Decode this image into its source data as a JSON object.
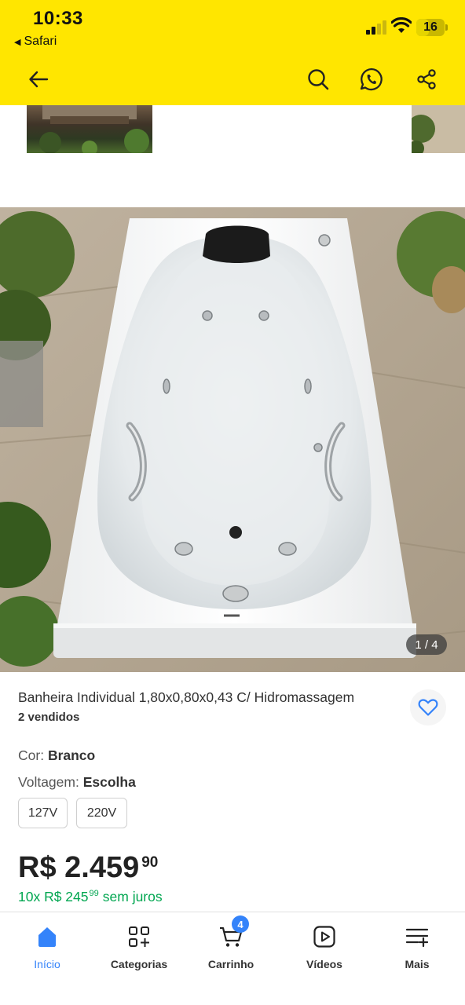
{
  "status_bar": {
    "time": "10:33",
    "back_app": "Safari",
    "battery": "16"
  },
  "header": {
    "icons": [
      "back-arrow-icon",
      "search-icon",
      "whatsapp-icon",
      "share-icon"
    ]
  },
  "gallery": {
    "counter": "1 / 4"
  },
  "product": {
    "title": "Banheira Individual 1,80x0,80x0,43 C/ Hidromassagem",
    "sold": "2 vendidos",
    "color_label": "Cor:",
    "color_value": "Branco",
    "voltage_label": "Voltagem:",
    "voltage_value": "Escolha",
    "voltage_options": [
      "127V",
      "220V"
    ],
    "price_main": "R$ 2.459",
    "price_cents": "90",
    "installments_prefix": "10x R$ 245",
    "installments_cents": "99",
    "installments_suffix": "sem juros"
  },
  "colors": {
    "header_bg": "#FFE600",
    "accent_blue": "#3483fa",
    "installment_green": "#00a650"
  },
  "bottom_nav": {
    "items": [
      {
        "label": "Início",
        "icon": "home-icon",
        "active": true
      },
      {
        "label": "Categorias",
        "icon": "categories-icon",
        "active": false
      },
      {
        "label": "Carrinho",
        "icon": "cart-icon",
        "active": false,
        "badge": "4"
      },
      {
        "label": "Vídeos",
        "icon": "video-icon",
        "active": false
      },
      {
        "label": "Mais",
        "icon": "more-icon",
        "active": false
      }
    ]
  }
}
